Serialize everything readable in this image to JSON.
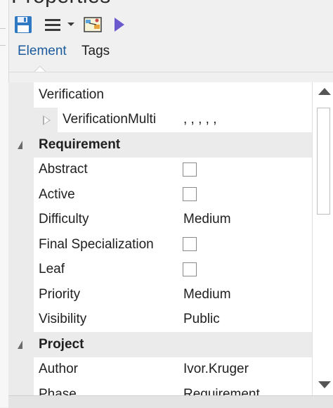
{
  "window": {
    "title": "Properties"
  },
  "toolbar": {
    "items": [
      {
        "icon": "save-icon"
      },
      {
        "icon": "hamburger-menu-icon"
      },
      {
        "icon": "chevron-down-icon"
      },
      {
        "icon": "map-diagram-icon"
      },
      {
        "icon": "play-arrow-icon"
      }
    ]
  },
  "tabs": [
    {
      "label": "Element",
      "active": true
    },
    {
      "label": "Tags",
      "active": false
    }
  ],
  "properties": {
    "top": {
      "verification_label": "Verification",
      "verification_multi_label": "VerificationMulti",
      "verification_multi_value": ", , , , ,"
    },
    "requirement": {
      "title": "Requirement",
      "abstract_label": "Abstract",
      "abstract_checked": false,
      "active_label": "Active",
      "active_checked": false,
      "difficulty_label": "Difficulty",
      "difficulty_value": "Medium",
      "final_spec_label": "Final Specialization",
      "final_spec_checked": false,
      "leaf_label": "Leaf",
      "leaf_checked": false,
      "priority_label": "Priority",
      "priority_value": "Medium",
      "visibility_label": "Visibility",
      "visibility_value": "Public"
    },
    "project": {
      "title": "Project",
      "author_label": "Author",
      "author_value": "Ivor.Kruger",
      "phase_label": "Phase",
      "phase_value": "Requirement"
    }
  },
  "colors": {
    "accent": "#1c5a9c",
    "play": "#6a5acd",
    "save": "#2f79c2"
  }
}
